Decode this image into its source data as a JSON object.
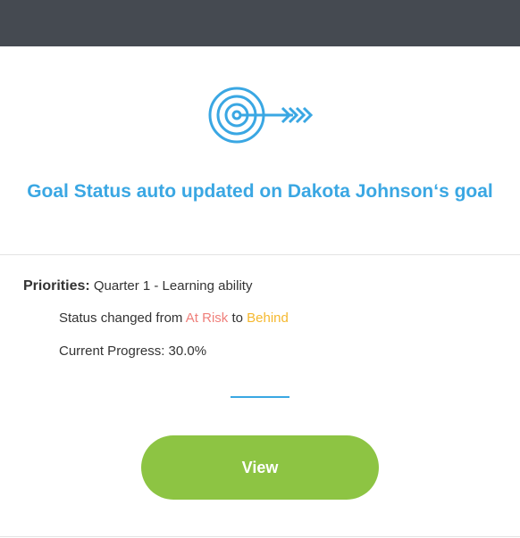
{
  "header": {},
  "notification": {
    "icon": "target-arrow-icon",
    "title": "Goal Status auto updated on Dakota Johnson‘s goal",
    "priorities_label": "Priorities:",
    "priorities_value": "Quarter 1 - Learning ability",
    "status_prefix": "Status changed from",
    "status_from": "At Risk",
    "status_joiner": "to",
    "status_to": "Behind",
    "progress_text": "Current Progress: 30.0%",
    "view_label": "View"
  },
  "colors": {
    "header_bg": "#454a51",
    "title": "#3aa7e3",
    "status_from": "#ef7f7a",
    "status_to": "#f5b82e",
    "button_bg": "#8dc443"
  }
}
